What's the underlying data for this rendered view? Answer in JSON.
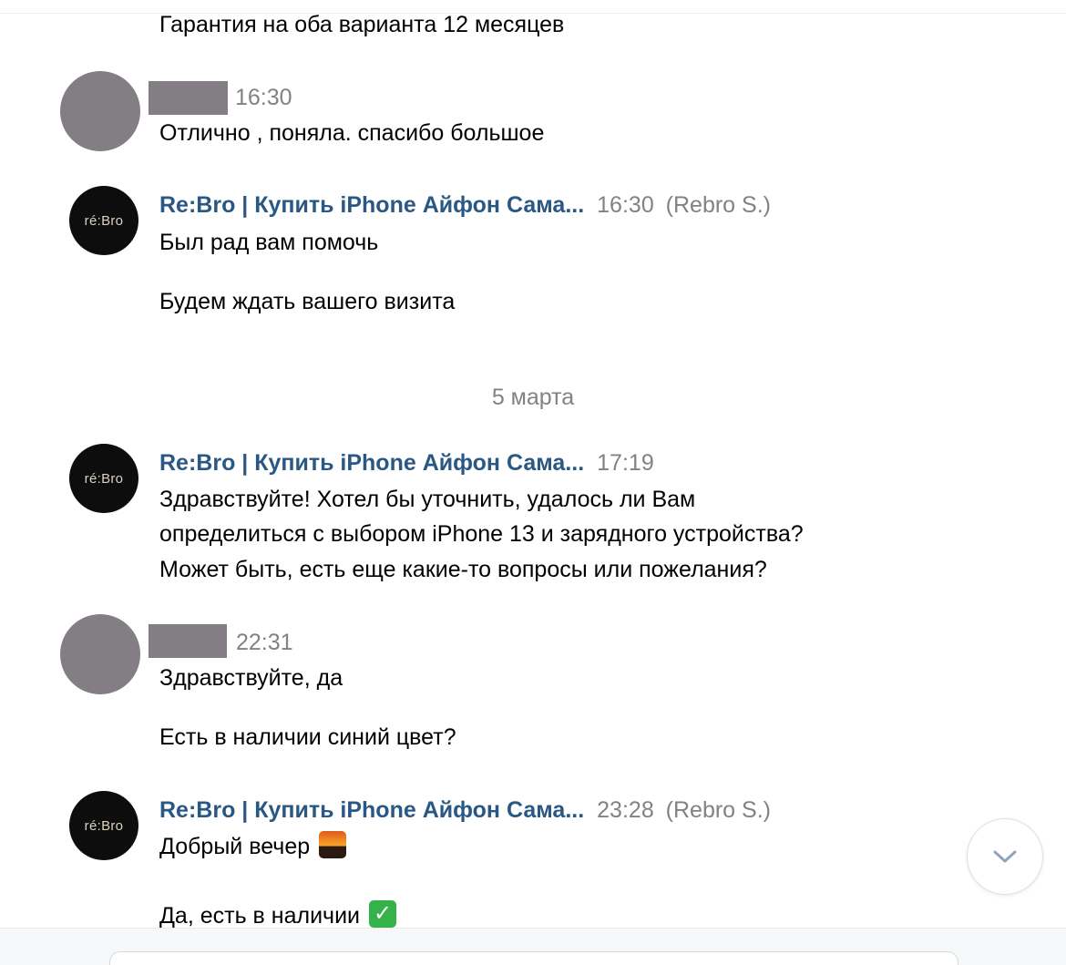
{
  "messages": {
    "m0": {
      "lines": [
        "Гарантия на оба варианта 12 месяцев"
      ]
    },
    "m1": {
      "time": "16:30",
      "lines": [
        "Отлично , поняла. спасибо большое"
      ]
    },
    "m2": {
      "avatar_text": "ré:Bro",
      "sender": "Re:Bro | Купить iPhone Айфон Сама...",
      "time": "16:30",
      "agent": "(Rebro S.)",
      "lines": [
        "Был рад вам помочь",
        "Будем ждать вашего визита"
      ]
    },
    "date_separator": "5 марта",
    "m3": {
      "avatar_text": "ré:Bro",
      "sender": "Re:Bro | Купить iPhone Айфон Сама...",
      "time": "17:19",
      "lines": [
        "Здравствуйте! Хотел бы уточнить, удалось ли Вам",
        "определиться с выбором iPhone 13 и зарядного устройства?",
        "Может быть, есть еще какие-то вопросы или пожелания?"
      ]
    },
    "m4": {
      "time": "22:31",
      "lines": [
        "Здравствуйте, да",
        "Есть в наличии синий цвет?"
      ]
    },
    "m5": {
      "avatar_text": "ré:Bro",
      "sender": "Re:Bro | Купить iPhone Айфон Сама...",
      "time": "23:28",
      "agent": "(Rebro S.)",
      "lines": [
        "Добрый вечер",
        "Да, есть в наличии"
      ],
      "emoji": [
        "city-sunset-emoji",
        "check-mark-emoji"
      ]
    }
  },
  "icons": {
    "scroll_down": "chevron-down-icon"
  },
  "colors": {
    "sender_link": "#2a5885",
    "timestamp": "#828282",
    "redaction": "#827e83",
    "brand_avatar_bg": "#0d0d0d",
    "check_emoji": "#35b34a"
  }
}
